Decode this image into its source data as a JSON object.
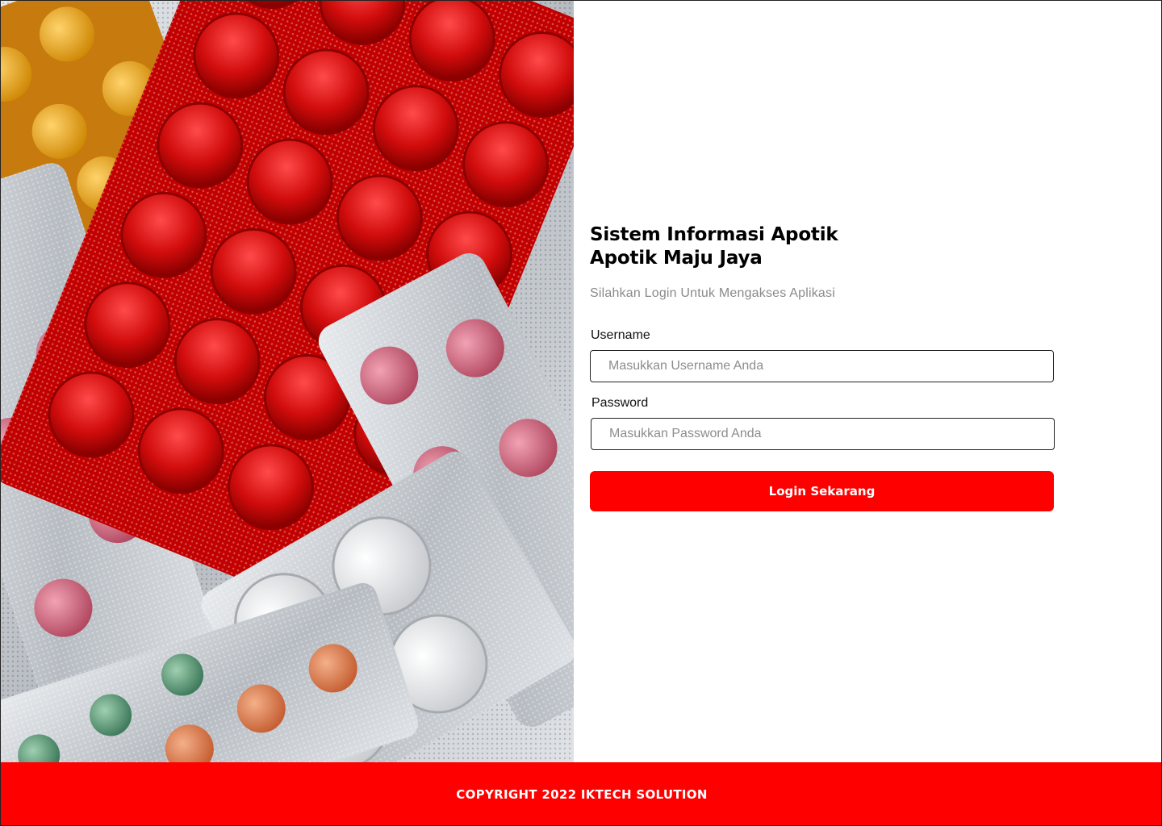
{
  "app": {
    "title_line1": "Sistem Informasi Apotik",
    "title_line2": "Apotik Maju Jaya",
    "subtitle": "Silahkan Login Untuk Mengakses Aplikasi"
  },
  "form": {
    "username_label": "Username",
    "username_placeholder": "Masukkan Username Anda",
    "username_value": "",
    "password_label": "Password",
    "password_placeholder": "Masukkan Password Anda",
    "password_value": "",
    "submit_label": "Login Sekarang"
  },
  "footer": {
    "copyright": "COPYRIGHT 2022 IKTECH SOLUTION"
  },
  "colors": {
    "accent": "#ff0000",
    "text": "#000000",
    "muted": "#8a8a8a"
  },
  "image": {
    "icon": "pill-blister-photo"
  }
}
